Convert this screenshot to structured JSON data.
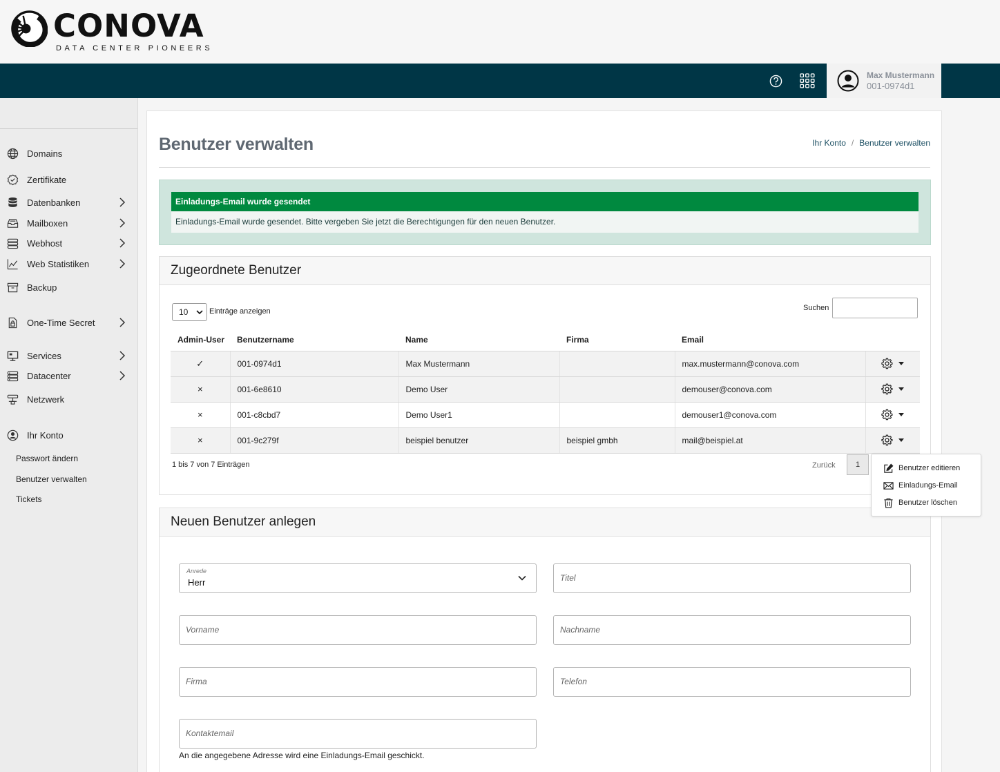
{
  "brand": {
    "name": "CONOVA",
    "tagline": "DATA CENTER PIONEERS"
  },
  "user": {
    "name": "Max Mustermann",
    "id": "001-0974d1"
  },
  "sidebar": {
    "items": [
      {
        "label": "Domains",
        "icon": "globe-icon"
      },
      {
        "label": "Zertifikate",
        "icon": "certificate-icon"
      },
      {
        "label": "Datenbanken",
        "icon": "database-icon"
      },
      {
        "label": "Mailboxen",
        "icon": "inbox-icon"
      },
      {
        "label": "Webhost",
        "icon": "server-icon"
      },
      {
        "label": "Web Statistiken",
        "icon": "chart-icon"
      },
      {
        "label": "Backup",
        "icon": "archive-icon"
      },
      {
        "label": "One-Time Secret",
        "icon": "lock-icon"
      },
      {
        "label": "Services",
        "icon": "monitor-icon"
      },
      {
        "label": "Datacenter",
        "icon": "rack-icon"
      },
      {
        "label": "Netzwerk",
        "icon": "network-icon"
      },
      {
        "label": "Ihr Konto",
        "icon": "user-icon"
      }
    ],
    "sub_items": [
      "Passwort ändern",
      "Benutzer verwalten",
      "Tickets"
    ]
  },
  "page": {
    "title": "Benutzer verwalten",
    "breadcrumb": [
      "Ihr Konto",
      "Benutzer verwalten"
    ],
    "breadcrumb_sep": "/"
  },
  "alert": {
    "title": "Einladungs-Email wurde gesendet",
    "body": "Einladungs-Email wurde gesendet. Bitte vergeben Sie jetzt die Berechtigungen für den neuen Benutzer."
  },
  "users_card": {
    "title": "Zugeordnete Benutzer",
    "length_value": "10",
    "length_label": "Einträge anzeigen",
    "search_label": "Suchen",
    "columns": [
      "Admin-User",
      "Benutzername",
      "Name",
      "Firma",
      "Email"
    ],
    "rows": [
      {
        "admin": "✓",
        "username": "001-0974d1",
        "name": "Max Mustermann",
        "company": "",
        "email": "max.mustermann@conova.com"
      },
      {
        "admin": "×",
        "username": "001-6e8610",
        "name": "Demo User",
        "company": "",
        "email": "demouser@conova.com"
      },
      {
        "admin": "×",
        "username": "001-c8cbd7",
        "name": "Demo User1",
        "company": "",
        "email": "demouser1@conova.com"
      },
      {
        "admin": "×",
        "username": "001-9c279f",
        "name": "beispiel benutzer",
        "company": "beispiel gmbh",
        "email": "mail@beispiel.at"
      }
    ],
    "info": "1 bis 7 von 7 Einträgen",
    "prev": "Zurück",
    "page": "1"
  },
  "action_menu": {
    "items": [
      {
        "label": "Benutzer editieren",
        "icon": "edit-icon"
      },
      {
        "label": "Einladungs-Email",
        "icon": "envelope-icon"
      },
      {
        "label": "Benutzer löschen",
        "icon": "trash-icon"
      }
    ]
  },
  "new_user": {
    "title": "Neuen Benutzer anlegen",
    "salutation_label": "Anrede",
    "salutation_value": "Herr",
    "title_ph": "Titel",
    "firstname_ph": "Vorname",
    "lastname_ph": "Nachname",
    "company_ph": "Firma",
    "phone_ph": "Telefon",
    "contact_email_ph": "Kontaktemail",
    "contact_hint": "An die angegebene Adresse wird eine Einladungs-Email geschickt."
  },
  "colors": {
    "navbar": "#003646",
    "alert_green": "#00893f",
    "alert_bg": "#cfe5dd"
  }
}
